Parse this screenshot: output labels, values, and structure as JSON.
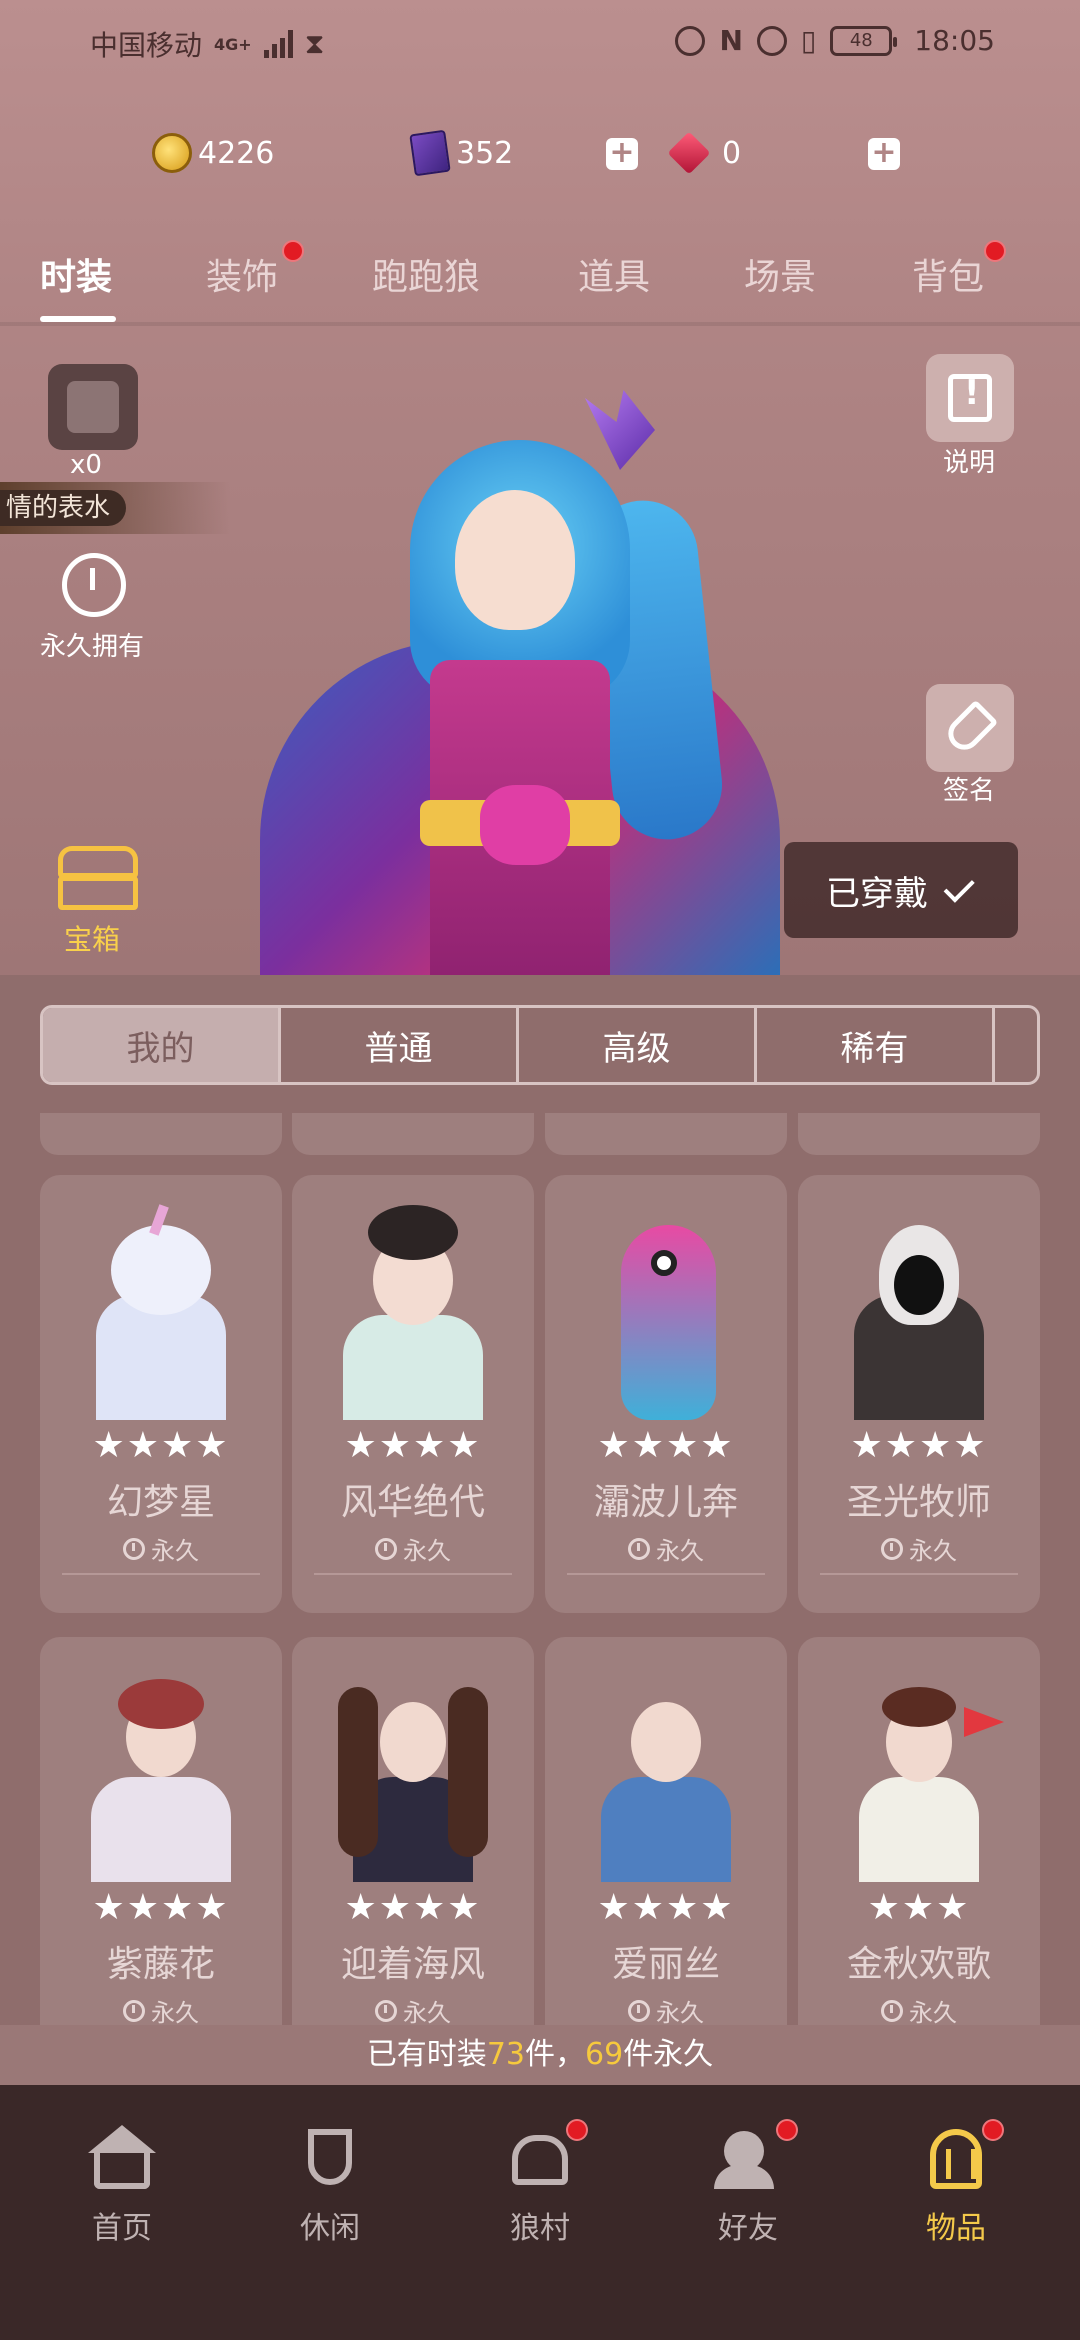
{
  "status_bar": {
    "carrier": "中国移动",
    "network": "4G+",
    "battery": "48",
    "time": "18:05"
  },
  "currency": {
    "coins": "4226",
    "books": "352",
    "gems": "0"
  },
  "tabs": [
    "时装",
    "装饰",
    "跑跑狼",
    "道具",
    "场景",
    "背包"
  ],
  "showcase": {
    "puzzle_count": "x0",
    "outfit_name": "情的表水",
    "ownership": "永久拥有",
    "instructions_label": "说明",
    "sign_label": "签名",
    "chest_label": "宝箱",
    "worn_label": "已穿戴"
  },
  "filters": [
    "我的",
    "普通",
    "高级",
    "稀有"
  ],
  "cards": [
    {
      "name": "幻梦星",
      "stars": "★★★★",
      "duration": "永久"
    },
    {
      "name": "风华绝代",
      "stars": "★★★★",
      "duration": "永久"
    },
    {
      "name": "灞波儿奔",
      "stars": "★★★★",
      "duration": "永久"
    },
    {
      "name": "圣光牧师",
      "stars": "★★★★",
      "duration": "永久"
    },
    {
      "name": "紫藤花",
      "stars": "★★★★",
      "duration": "永久"
    },
    {
      "name": "迎着海风",
      "stars": "★★★★",
      "duration": "永久"
    },
    {
      "name": "爱丽丝",
      "stars": "★★★★",
      "duration": "永久"
    },
    {
      "name": "金秋欢歌",
      "stars": "★★★",
      "duration": "永久"
    }
  ],
  "summary": {
    "prefix": "已有时装",
    "total": "73",
    "middle": "件，",
    "permanent": "69",
    "suffix": "件永久"
  },
  "bottom_nav": [
    "首页",
    "休闲",
    "狼村",
    "好友",
    "物品"
  ],
  "colors": {
    "accent_gold": "#f6c93d",
    "badge_red": "#e21b23",
    "nav_bg": "#3a2828"
  }
}
